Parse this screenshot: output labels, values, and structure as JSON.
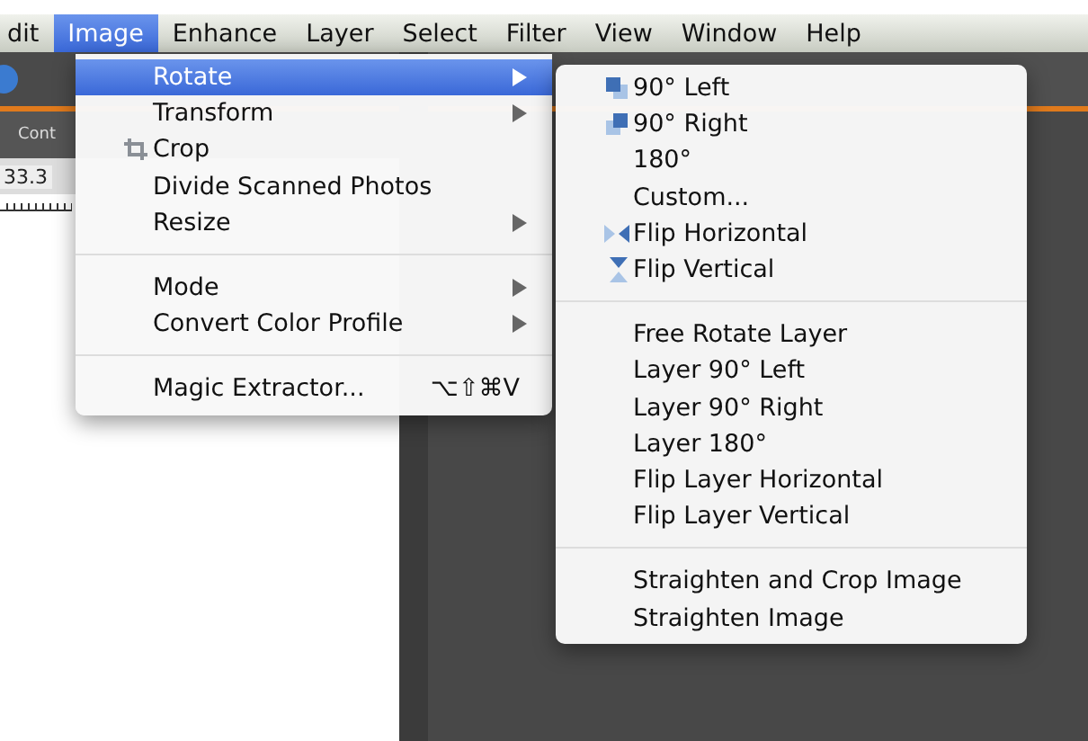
{
  "menubar": [
    {
      "label": "dit",
      "selected": false
    },
    {
      "label": "Image",
      "selected": true
    },
    {
      "label": "Enhance",
      "selected": false
    },
    {
      "label": "Layer",
      "selected": false
    },
    {
      "label": "Select",
      "selected": false
    },
    {
      "label": "Filter",
      "selected": false
    },
    {
      "label": "View",
      "selected": false
    },
    {
      "label": "Window",
      "selected": false
    },
    {
      "label": "Help",
      "selected": false
    }
  ],
  "options_bar": {
    "label": "Cont",
    "field_value": "33.3"
  },
  "image_menu": [
    [
      {
        "label": "Rotate",
        "kind": "plain",
        "submenu": true,
        "selected": true
      },
      {
        "label": "Transform",
        "kind": "plain",
        "submenu": true,
        "selected": false
      },
      {
        "label": "Crop",
        "kind": "crop",
        "submenu": false,
        "selected": false
      },
      {
        "label": "Divide Scanned Photos",
        "kind": "plain",
        "submenu": false,
        "selected": false
      },
      {
        "label": "Resize",
        "kind": "plain",
        "submenu": true,
        "selected": false
      }
    ],
    [
      {
        "label": "Mode",
        "kind": "plain",
        "submenu": true,
        "selected": false
      },
      {
        "label": "Convert Color Profile",
        "kind": "plain",
        "submenu": true,
        "selected": false
      }
    ],
    [
      {
        "label": "Magic Extractor...",
        "kind": "plain",
        "submenu": false,
        "selected": false,
        "shortcut": "⌥⇧⌘V"
      }
    ]
  ],
  "rotate_submenu": [
    [
      {
        "label": "90° Left",
        "kind": "rotate_left"
      },
      {
        "label": "90° Right",
        "kind": "rotate_right"
      },
      {
        "label": "180°",
        "kind": "plain"
      },
      {
        "label": "Custom...",
        "kind": "plain"
      },
      {
        "label": "Flip Horizontal",
        "kind": "flip_h"
      },
      {
        "label": "Flip Vertical",
        "kind": "flip_v"
      }
    ],
    [
      {
        "label": "Free Rotate Layer",
        "kind": "plain"
      },
      {
        "label": "Layer 90° Left",
        "kind": "plain"
      },
      {
        "label": "Layer 90° Right",
        "kind": "plain"
      },
      {
        "label": "Layer 180°",
        "kind": "plain"
      },
      {
        "label": "Flip Layer Horizontal",
        "kind": "plain"
      },
      {
        "label": "Flip Layer Vertical",
        "kind": "plain"
      }
    ],
    [
      {
        "label": "Straighten and Crop Image",
        "kind": "plain"
      },
      {
        "label": "Straighten Image",
        "kind": "plain"
      }
    ]
  ]
}
